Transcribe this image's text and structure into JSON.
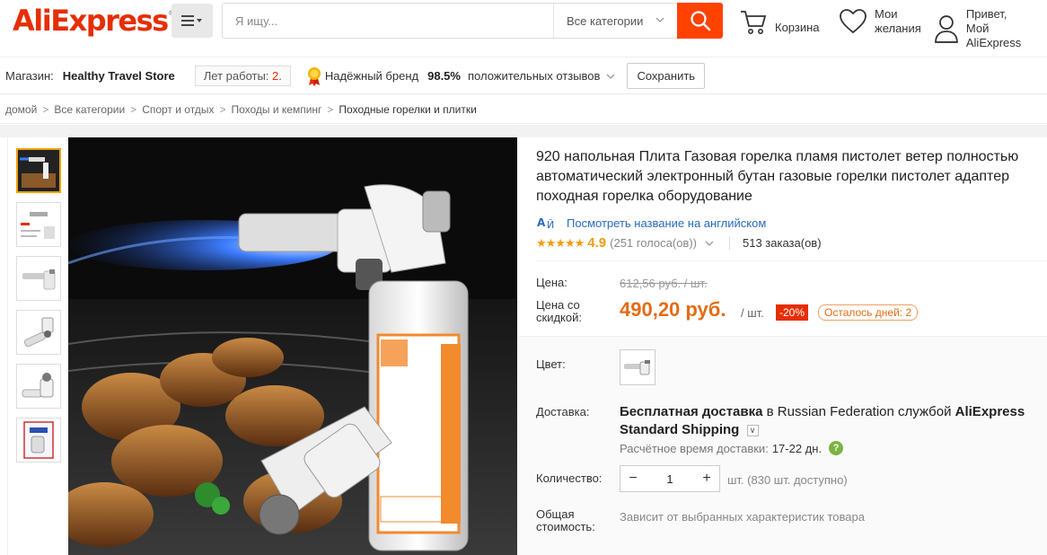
{
  "header": {
    "logo": "AliExpress",
    "search_placeholder": "Я ищу...",
    "category_select": "Все категории",
    "cart_label": "Корзина",
    "wishlist_line1": "Мои",
    "wishlist_line2": "желания",
    "account_line1": "Привет,",
    "account_line2": "Мой AliExpress"
  },
  "store": {
    "label": "Магазин:",
    "name": "Healthy Travel Store",
    "years_label": "Лет работы:",
    "years_value": "2",
    "years_suffix": ".",
    "brand_label": "Надёжный бренд",
    "positive_pct": "98.5%",
    "positive_label": "положительных отзывов",
    "save_label": "Сохранить"
  },
  "breadcrumb": {
    "items": [
      "домой",
      "Все категории",
      "Спорт и отдых",
      "Походы и кемпинг",
      "Походные горелки и плитки"
    ],
    "separator": ">"
  },
  "product": {
    "title": "920 напольная Плита Газовая горелка пламя пистолет ветер полностью автоматический электронный бутан газовые горелки пистолет адаптер походная горелка оборудование",
    "translate_link": "Посмотреть название на английском",
    "rating_score": "4.9",
    "votes": "(251 голоса(ов))",
    "orders": "513 заказа(ов)",
    "price_label": "Цена:",
    "old_price": "612,56 руб. / шт.",
    "discount_price_label_1": "Цена со",
    "discount_price_label_2": "скидкой:",
    "new_price": "490,20 руб.",
    "per_unit": "/ шт.",
    "discount_badge": "-20%",
    "days_left": "Осталось дней: 2",
    "color_label": "Цвет:",
    "shipping_label": "Доставка:",
    "shipping_bold_1": "Бесплатная доставка",
    "shipping_in": "в",
    "shipping_country": "Russian Federation",
    "shipping_service_pre": "службой",
    "shipping_service": "AliExpress Standard Shipping",
    "eta_label": "Расчётное время доставки:",
    "eta_value": "17-22 дн.",
    "quantity_label": "Количество:",
    "quantity_value": "1",
    "availability": "шт. (830 шт. доступно)",
    "total_label_1": "Общая",
    "total_label_2": "стоимость:",
    "total_value": "Зависит от выбранных характеристик товара"
  },
  "colors": {
    "brand_red": "#e62e04",
    "search_orange": "#ff4200",
    "price_orange": "#e36c16",
    "star_gold": "#f39c12",
    "link_blue": "#2a6bbd"
  }
}
